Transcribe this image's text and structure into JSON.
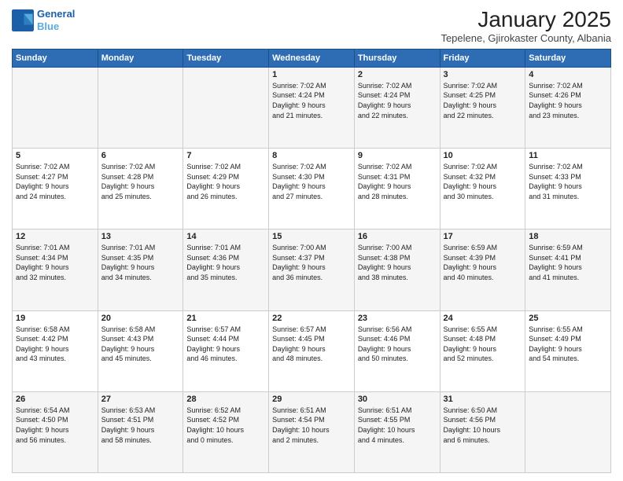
{
  "logo": {
    "line1": "General",
    "line2": "Blue"
  },
  "title": "January 2025",
  "subtitle": "Tepelene, Gjirokaster County, Albania",
  "days_of_week": [
    "Sunday",
    "Monday",
    "Tuesday",
    "Wednesday",
    "Thursday",
    "Friday",
    "Saturday"
  ],
  "weeks": [
    [
      {
        "day": "",
        "info": ""
      },
      {
        "day": "",
        "info": ""
      },
      {
        "day": "",
        "info": ""
      },
      {
        "day": "1",
        "info": "Sunrise: 7:02 AM\nSunset: 4:24 PM\nDaylight: 9 hours\nand 21 minutes."
      },
      {
        "day": "2",
        "info": "Sunrise: 7:02 AM\nSunset: 4:24 PM\nDaylight: 9 hours\nand 22 minutes."
      },
      {
        "day": "3",
        "info": "Sunrise: 7:02 AM\nSunset: 4:25 PM\nDaylight: 9 hours\nand 22 minutes."
      },
      {
        "day": "4",
        "info": "Sunrise: 7:02 AM\nSunset: 4:26 PM\nDaylight: 9 hours\nand 23 minutes."
      }
    ],
    [
      {
        "day": "5",
        "info": "Sunrise: 7:02 AM\nSunset: 4:27 PM\nDaylight: 9 hours\nand 24 minutes."
      },
      {
        "day": "6",
        "info": "Sunrise: 7:02 AM\nSunset: 4:28 PM\nDaylight: 9 hours\nand 25 minutes."
      },
      {
        "day": "7",
        "info": "Sunrise: 7:02 AM\nSunset: 4:29 PM\nDaylight: 9 hours\nand 26 minutes."
      },
      {
        "day": "8",
        "info": "Sunrise: 7:02 AM\nSunset: 4:30 PM\nDaylight: 9 hours\nand 27 minutes."
      },
      {
        "day": "9",
        "info": "Sunrise: 7:02 AM\nSunset: 4:31 PM\nDaylight: 9 hours\nand 28 minutes."
      },
      {
        "day": "10",
        "info": "Sunrise: 7:02 AM\nSunset: 4:32 PM\nDaylight: 9 hours\nand 30 minutes."
      },
      {
        "day": "11",
        "info": "Sunrise: 7:02 AM\nSunset: 4:33 PM\nDaylight: 9 hours\nand 31 minutes."
      }
    ],
    [
      {
        "day": "12",
        "info": "Sunrise: 7:01 AM\nSunset: 4:34 PM\nDaylight: 9 hours\nand 32 minutes."
      },
      {
        "day": "13",
        "info": "Sunrise: 7:01 AM\nSunset: 4:35 PM\nDaylight: 9 hours\nand 34 minutes."
      },
      {
        "day": "14",
        "info": "Sunrise: 7:01 AM\nSunset: 4:36 PM\nDaylight: 9 hours\nand 35 minutes."
      },
      {
        "day": "15",
        "info": "Sunrise: 7:00 AM\nSunset: 4:37 PM\nDaylight: 9 hours\nand 36 minutes."
      },
      {
        "day": "16",
        "info": "Sunrise: 7:00 AM\nSunset: 4:38 PM\nDaylight: 9 hours\nand 38 minutes."
      },
      {
        "day": "17",
        "info": "Sunrise: 6:59 AM\nSunset: 4:39 PM\nDaylight: 9 hours\nand 40 minutes."
      },
      {
        "day": "18",
        "info": "Sunrise: 6:59 AM\nSunset: 4:41 PM\nDaylight: 9 hours\nand 41 minutes."
      }
    ],
    [
      {
        "day": "19",
        "info": "Sunrise: 6:58 AM\nSunset: 4:42 PM\nDaylight: 9 hours\nand 43 minutes."
      },
      {
        "day": "20",
        "info": "Sunrise: 6:58 AM\nSunset: 4:43 PM\nDaylight: 9 hours\nand 45 minutes."
      },
      {
        "day": "21",
        "info": "Sunrise: 6:57 AM\nSunset: 4:44 PM\nDaylight: 9 hours\nand 46 minutes."
      },
      {
        "day": "22",
        "info": "Sunrise: 6:57 AM\nSunset: 4:45 PM\nDaylight: 9 hours\nand 48 minutes."
      },
      {
        "day": "23",
        "info": "Sunrise: 6:56 AM\nSunset: 4:46 PM\nDaylight: 9 hours\nand 50 minutes."
      },
      {
        "day": "24",
        "info": "Sunrise: 6:55 AM\nSunset: 4:48 PM\nDaylight: 9 hours\nand 52 minutes."
      },
      {
        "day": "25",
        "info": "Sunrise: 6:55 AM\nSunset: 4:49 PM\nDaylight: 9 hours\nand 54 minutes."
      }
    ],
    [
      {
        "day": "26",
        "info": "Sunrise: 6:54 AM\nSunset: 4:50 PM\nDaylight: 9 hours\nand 56 minutes."
      },
      {
        "day": "27",
        "info": "Sunrise: 6:53 AM\nSunset: 4:51 PM\nDaylight: 9 hours\nand 58 minutes."
      },
      {
        "day": "28",
        "info": "Sunrise: 6:52 AM\nSunset: 4:52 PM\nDaylight: 10 hours\nand 0 minutes."
      },
      {
        "day": "29",
        "info": "Sunrise: 6:51 AM\nSunset: 4:54 PM\nDaylight: 10 hours\nand 2 minutes."
      },
      {
        "day": "30",
        "info": "Sunrise: 6:51 AM\nSunset: 4:55 PM\nDaylight: 10 hours\nand 4 minutes."
      },
      {
        "day": "31",
        "info": "Sunrise: 6:50 AM\nSunset: 4:56 PM\nDaylight: 10 hours\nand 6 minutes."
      },
      {
        "day": "",
        "info": ""
      }
    ]
  ]
}
